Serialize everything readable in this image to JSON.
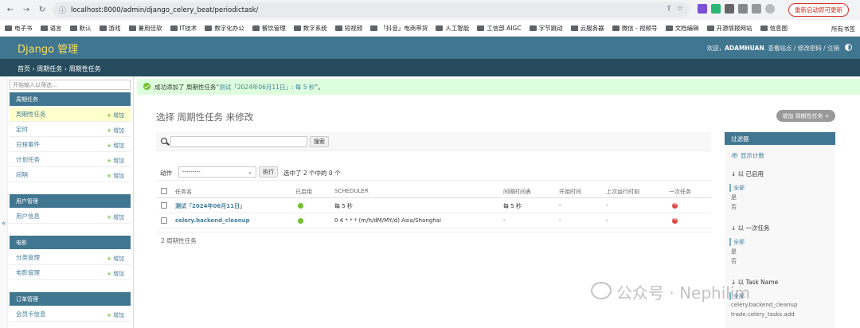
{
  "browser": {
    "url": "localhost:8000/admin/django_celery_beat/periodictask/",
    "restart_label": "重新启动即可更新",
    "bookmarks": [
      "电子书",
      "语言",
      "默认",
      "游戏",
      "薯用佳软",
      "IT技术",
      "数字化办公",
      "餐饮管理",
      "数字系统",
      "短视频",
      "「抖音」电商带货",
      "人工智能",
      "工信部 AIGC",
      "字节跳动",
      "云服务器",
      "微信 - 视频号",
      "文档编辑",
      "开源情报网站",
      "信息图"
    ],
    "bookmarks_more": "所有书签"
  },
  "header": {
    "brand": "Django 管理",
    "welcome": "欢迎，",
    "username": "ADAMHUAN",
    "links": "查看站点 / 修改密码 / 注销"
  },
  "breadcrumb": "首页 › 周期任务 › 周期性任务",
  "sidebar": {
    "filter_placeholder": "开始输入以筛选...",
    "apps": [
      {
        "caption": "周期任务",
        "models": [
          {
            "label": "周期性任务",
            "add": "增加",
            "current": true
          },
          {
            "label": "定时",
            "add": "增加"
          },
          {
            "label": "日程事件",
            "add": "增加"
          },
          {
            "label": "计划任务",
            "add": "增加"
          },
          {
            "label": "间隔",
            "add": "增加"
          }
        ]
      },
      {
        "caption": "用户管理",
        "models": [
          {
            "label": "用户信息",
            "add": "增加"
          }
        ]
      },
      {
        "caption": "电影",
        "models": [
          {
            "label": "分类管理",
            "add": "增加"
          },
          {
            "label": "电影管理",
            "add": "增加"
          }
        ]
      },
      {
        "caption": "订单管理",
        "models": [
          {
            "label": "会员卡信息",
            "add": "增加"
          }
        ]
      }
    ],
    "collapse_label": "«"
  },
  "message": {
    "prefix": "成功添加了 周期性任务“",
    "link": "测试「2024年06月11日」: 每 5 秒",
    "suffix": "”。"
  },
  "content": {
    "title": "选择 周期性任务 来修改",
    "add_button": "增加 周期性任务 +",
    "search_button": "搜索",
    "action_label": "动作",
    "action_select": "---------",
    "go_button": "执行",
    "selection_counter": "选中了 2 个中的 0 个",
    "columns": [
      "任务名",
      "已启用",
      "SCHEDULER",
      "间隔时间表",
      "开始时间",
      "上次运行时刻",
      "一次任务"
    ],
    "rows": [
      {
        "name": "测试「2024年06月11日」",
        "enabled": true,
        "scheduler": "每 5 秒",
        "interval": "每 5 秒",
        "start": "-",
        "last_run": "-",
        "one_off": false
      },
      {
        "name": "celery.backend_cleanup",
        "enabled": true,
        "scheduler": "0 4 * * * (m/h/dM/MY/d) Asia/Shanghai",
        "interval": "-",
        "start": "-",
        "last_run": "-",
        "one_off": false
      }
    ],
    "paginator": "2 周期性任务"
  },
  "filter": {
    "title": "过滤器",
    "show_counts": "显示计数",
    "groups": [
      {
        "heading": "↓ 以 已启用",
        "options": [
          "全部",
          "是",
          "否"
        ]
      },
      {
        "heading": "↓ 以 一次任务",
        "options": [
          "全部",
          "是",
          "否"
        ]
      },
      {
        "heading": "↓ 以 Task Name",
        "options": [
          "全部",
          "celery.backend_cleanup",
          "trade.celery_tasks.add"
        ]
      }
    ]
  },
  "watermark": "公众号 · Nephilim",
  "colors": {
    "header": "#417690",
    "breadcrumb": "#264b5d",
    "brand": "#f5dd5d",
    "success": "#dfd",
    "link": "#447e9b",
    "yes": "#70bf2b",
    "no": "#dd4646"
  }
}
